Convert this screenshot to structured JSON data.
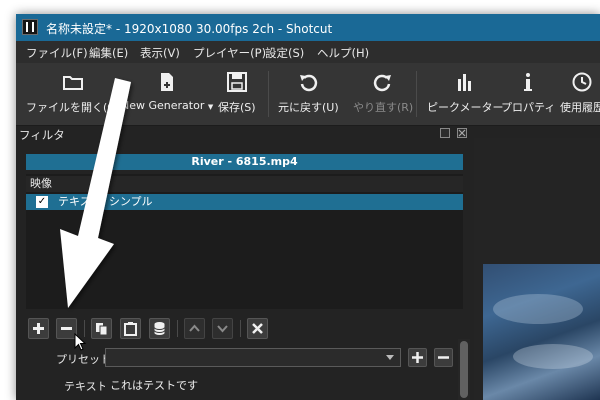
{
  "window": {
    "title": "名称未設定* - 1920x1080 30.00fps 2ch - Shotcut"
  },
  "menu": [
    "ファイル(F)",
    "編集(E)",
    "表示(V)",
    "プレイヤー(P)",
    "設定(S)",
    "ヘルプ(H)"
  ],
  "toolbar": {
    "open_file": "ファイルを開く(O)",
    "new_generator": "New Generator",
    "save": "保存(S)",
    "undo": "元に戻す(U)",
    "redo": "やり直す(R)",
    "peak_meter": "ピークメーター",
    "properties": "プロパティ",
    "history": "使用履歴"
  },
  "filters_panel": {
    "title": "フィルタ",
    "file_name": "River - 6815.mp4",
    "category": "映像",
    "filter_item": "テキスト: シンプル",
    "filter_checked": true
  },
  "preset": {
    "label": "プリセット",
    "value": ""
  },
  "text_field": {
    "label": "テキスト",
    "value": "これはテストです"
  },
  "colors": {
    "accent": "#1f6f93",
    "titlebar": "#1a6996",
    "background": "#232323"
  }
}
